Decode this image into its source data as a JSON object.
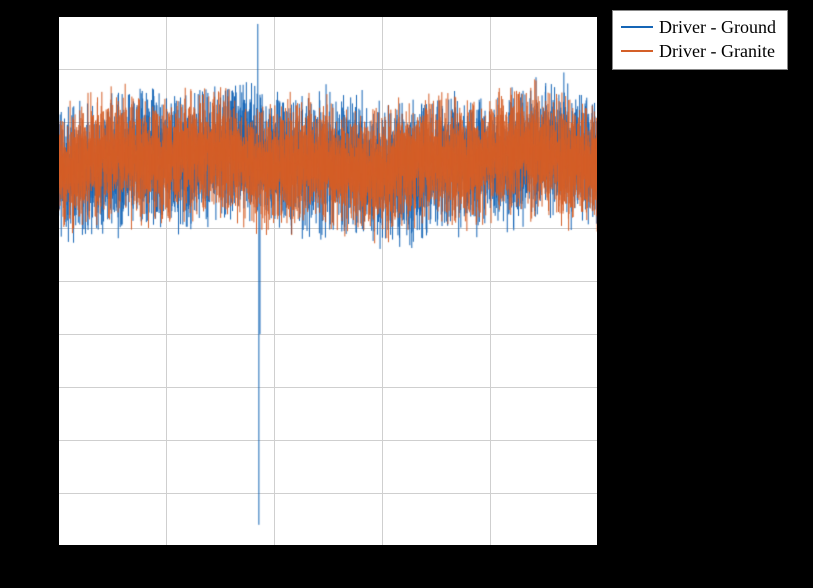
{
  "chart_data": {
    "type": "line",
    "title": "",
    "xlabel": "",
    "ylabel": "",
    "xlim": [
      0,
      2500
    ],
    "ylim": [
      -140,
      60
    ],
    "xticks": [
      0,
      500,
      1000,
      1500,
      2000,
      2500
    ],
    "yticks": [
      -140,
      -120,
      -100,
      -80,
      -60,
      -40,
      -20,
      0,
      20,
      40,
      60
    ],
    "grid": true,
    "legend_position": "outside-top-right",
    "colors": {
      "ground": "#1565b6",
      "granite": "#d45f28"
    },
    "series": [
      {
        "name": "Driver - Ground",
        "color": "#1565b6",
        "noise_center": 5,
        "noise_amp": 30,
        "outliers": [
          {
            "x": 925,
            "y": 57
          },
          {
            "x": 930,
            "y": -132
          },
          {
            "x": 935,
            "y": -60
          }
        ]
      },
      {
        "name": "Driver - Granite",
        "color": "#d45f28",
        "noise_center": 5,
        "noise_amp": 28,
        "outliers": []
      }
    ]
  }
}
